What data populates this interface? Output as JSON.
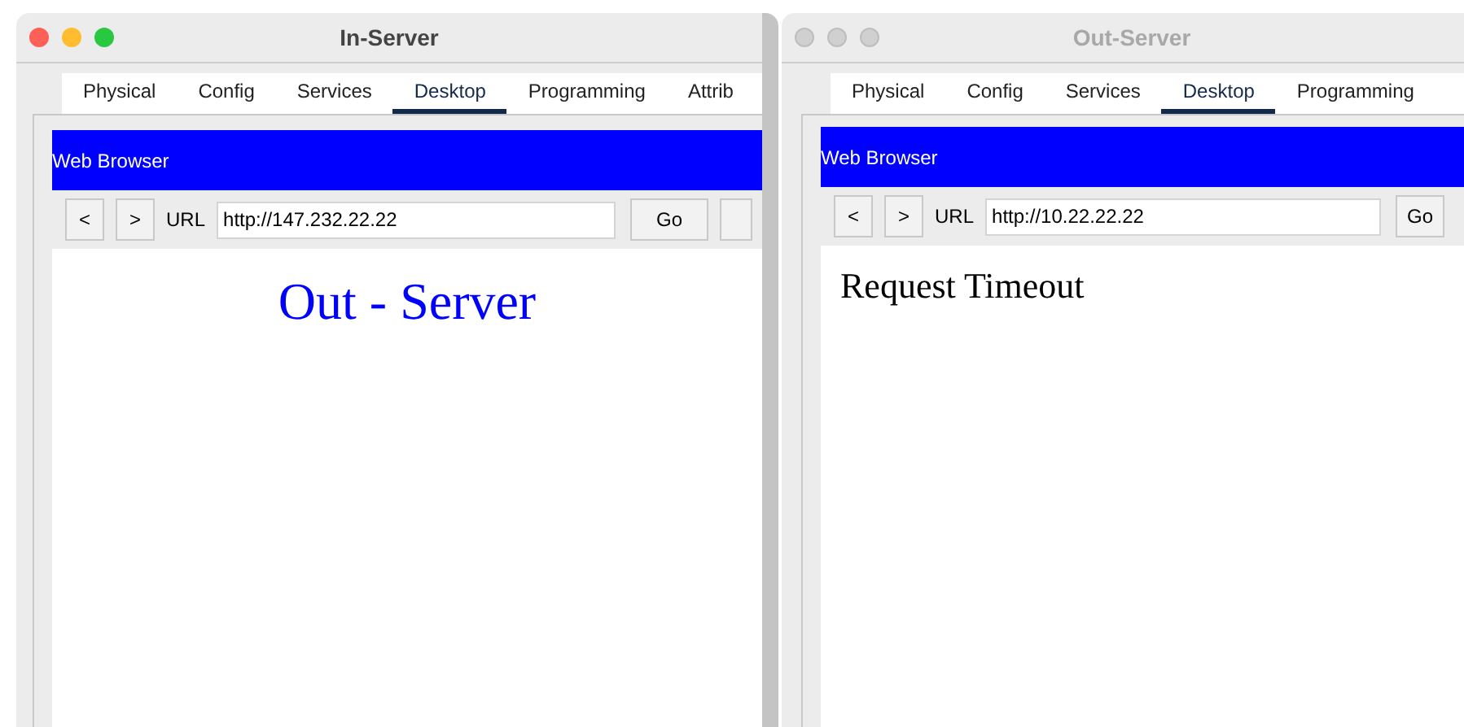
{
  "windows": [
    {
      "title": "In-Server",
      "active": true,
      "tabs": [
        {
          "label": "Physical",
          "selected": false
        },
        {
          "label": "Config",
          "selected": false
        },
        {
          "label": "Services",
          "selected": false
        },
        {
          "label": "Desktop",
          "selected": true
        },
        {
          "label": "Programming",
          "selected": false
        },
        {
          "label": "Attrib",
          "selected": false
        }
      ],
      "panel_title": "Web Browser",
      "back": "<",
      "forward": ">",
      "url_label": "URL",
      "url": "http://147.232.22.22",
      "go": "Go",
      "extra_button": true,
      "page": {
        "kind": "heading",
        "text": "Out - Server"
      }
    },
    {
      "title": "Out-Server",
      "active": false,
      "tabs": [
        {
          "label": "Physical",
          "selected": false
        },
        {
          "label": "Config",
          "selected": false
        },
        {
          "label": "Services",
          "selected": false
        },
        {
          "label": "Desktop",
          "selected": true
        },
        {
          "label": "Programming",
          "selected": false
        }
      ],
      "panel_title": "Web Browser",
      "back": "<",
      "forward": ">",
      "url_label": "URL",
      "url": "http://10.22.22.22",
      "go": "Go",
      "extra_button": false,
      "page": {
        "kind": "plain",
        "text": "Request Timeout"
      }
    }
  ]
}
